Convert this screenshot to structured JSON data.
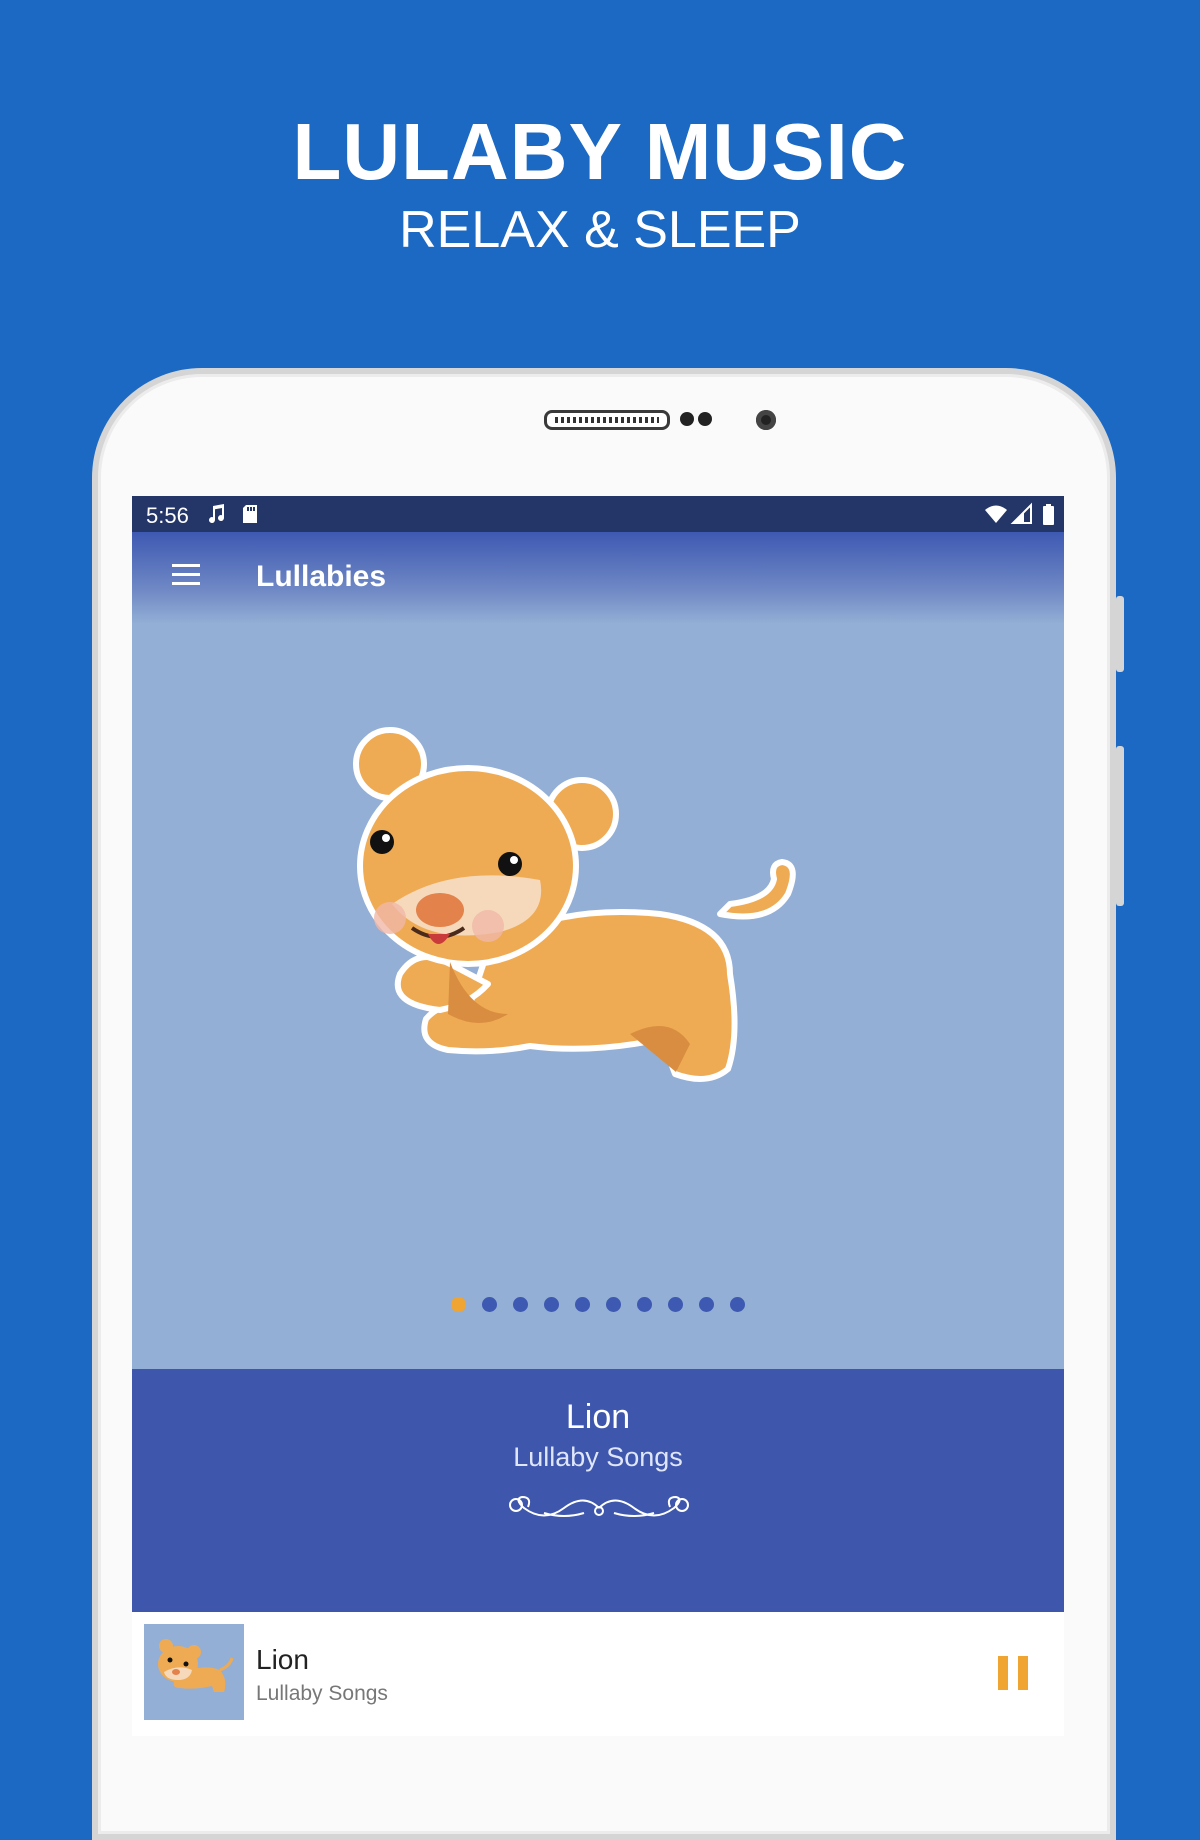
{
  "promo": {
    "title": "LULABY MUSIC",
    "subtitle": "RELAX & SLEEP"
  },
  "status_bar": {
    "time": "5:56",
    "icons": [
      "music-note-icon",
      "sd-card-icon",
      "wifi-icon",
      "signal-icon",
      "battery-icon"
    ]
  },
  "app_bar": {
    "title": "Lullabies",
    "menu_icon": "hamburger-menu-icon"
  },
  "carousel": {
    "current_index": 0,
    "page_count": 10
  },
  "now_playing": {
    "title": "Lion",
    "subtitle": "Lullaby Songs"
  },
  "mini_player": {
    "title": "Lion",
    "subtitle": "Lullaby Songs",
    "state": "playing",
    "control_icon": "pause-icon"
  },
  "colors": {
    "background": "#1b69c3",
    "status_bar": "#243567",
    "artwork_bg": "#93afd5",
    "info_panel": "#3e57ad",
    "accent": "#f0a431",
    "dot_inactive": "#3e59b2"
  }
}
